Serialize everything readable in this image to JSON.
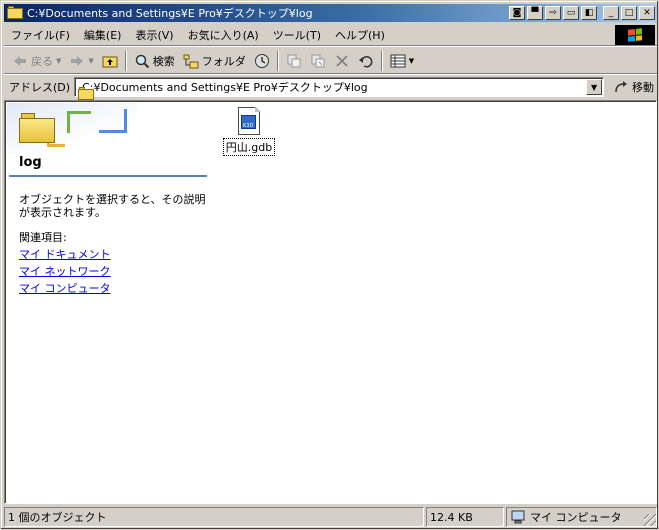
{
  "window": {
    "title": "C:¥Documents and Settings¥E Pro¥デスクトップ¥log",
    "title_buttons": [
      "nvidia-icon",
      "pin-icon",
      "shade-icon",
      "maximize-alt-icon",
      "restore-icon",
      "minimize-icon",
      "maximize-icon",
      "close-icon"
    ]
  },
  "menubar": {
    "items": [
      "ファイル(F)",
      "編集(E)",
      "表示(V)",
      "お気に入り(A)",
      "ツール(T)",
      "ヘルプ(H)"
    ]
  },
  "toolbar": {
    "back_label": "戻る",
    "search_label": "検索",
    "folders_label": "フォルダ"
  },
  "address": {
    "label": "アドレス(D)",
    "value": "C:¥Documents and Settings¥E Pro¥デスクトップ¥log",
    "go_label": "移動"
  },
  "taskpane": {
    "folder_name": "log",
    "description": "オブジェクトを選択すると、その説明が表示されます。",
    "related_heading": "関連項目:",
    "links": [
      "マイ ドキュメント",
      "マイ ネットワーク",
      "マイ コンピュータ"
    ]
  },
  "files": [
    {
      "name": "円山.gdb",
      "badge": "K3D"
    }
  ],
  "status": {
    "objects": "1 個のオブジェクト",
    "size": "12.4 KB",
    "location": "マイ コンピュータ"
  },
  "colors": {
    "titlebar_start": "#0a246a",
    "titlebar_end": "#a6caf0",
    "link": "#0000ee",
    "chrome": "#d4d0c8"
  }
}
